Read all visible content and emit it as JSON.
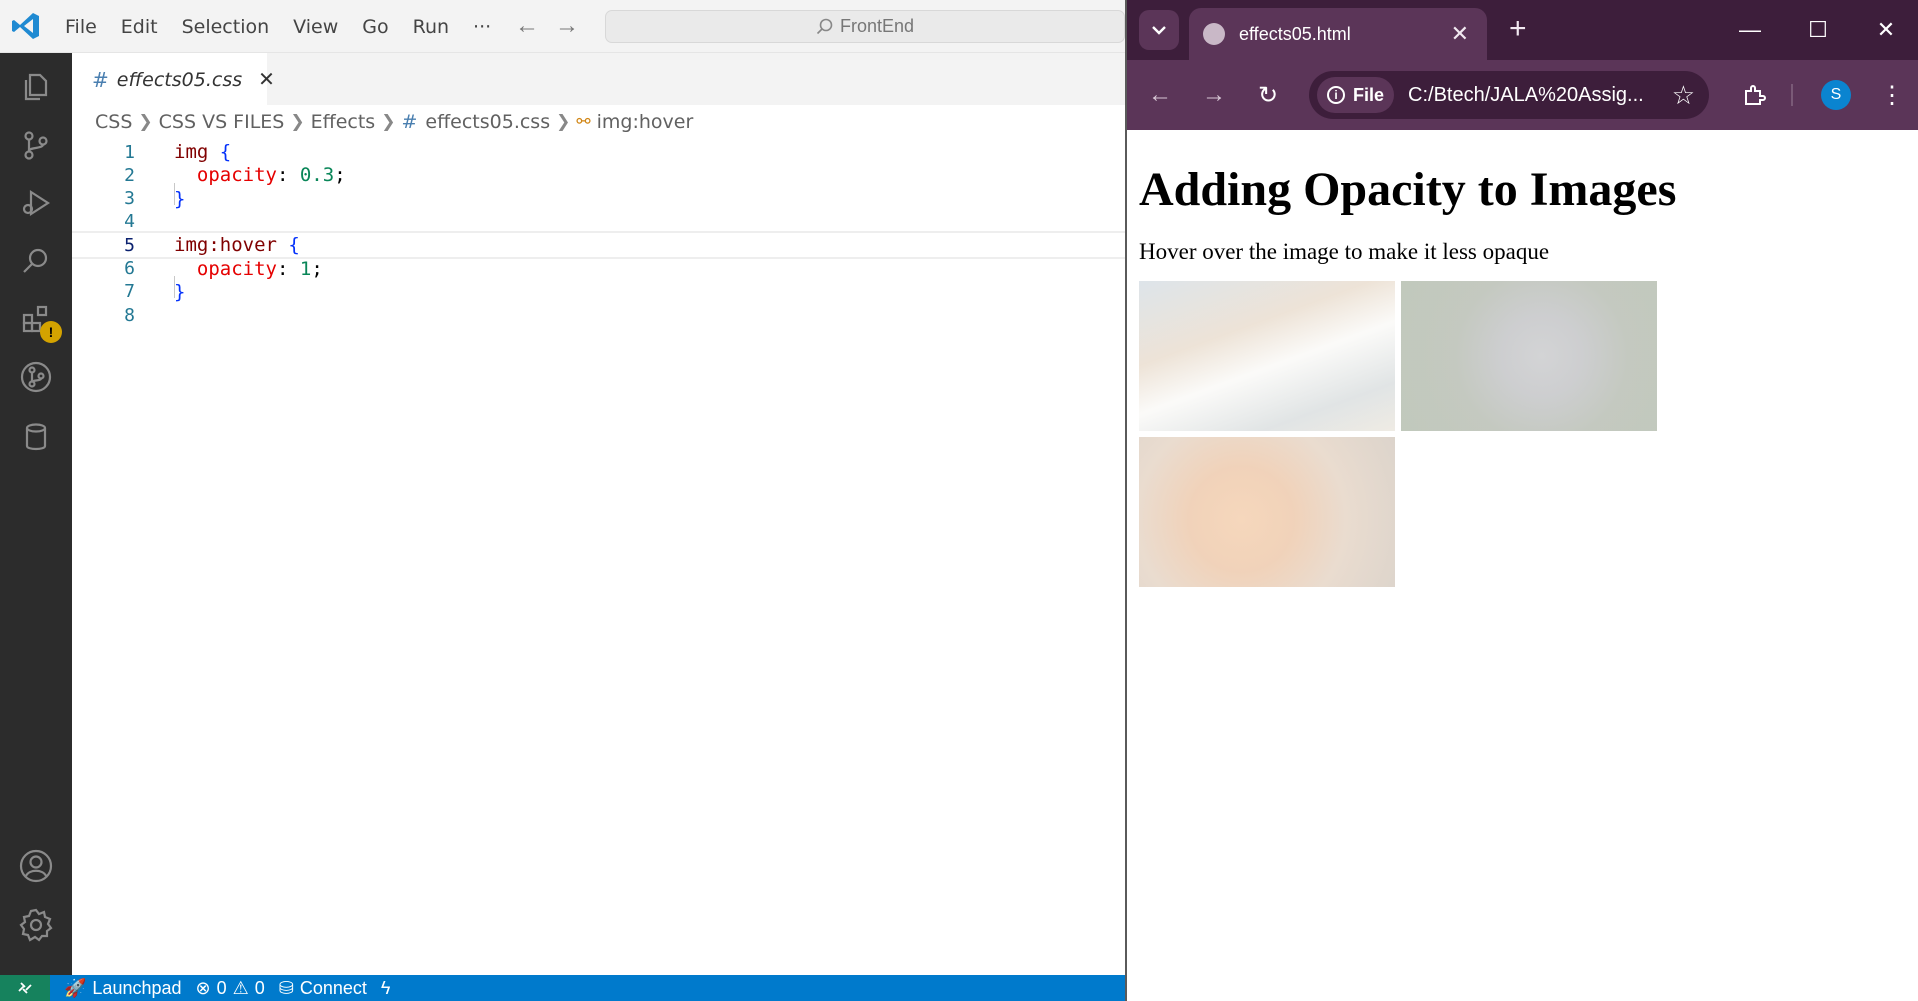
{
  "vscode": {
    "menu": [
      "File",
      "Edit",
      "Selection",
      "View",
      "Go",
      "Run",
      "···"
    ],
    "search_text": "FrontEnd",
    "tab": {
      "label": "effects05.css"
    },
    "breadcrumb": [
      "CSS",
      "CSS VS FILES",
      "Effects",
      "effects05.css",
      "img:hover"
    ],
    "code_lines": [
      {
        "n": "1",
        "tokens": [
          [
            "sel",
            "img"
          ],
          [
            "punc",
            " "
          ],
          [
            "brace",
            "{"
          ]
        ]
      },
      {
        "n": "2",
        "tokens": [
          [
            "punc",
            "  "
          ],
          [
            "prop",
            "opacity"
          ],
          [
            "punc",
            ": "
          ],
          [
            "num",
            "0.3"
          ],
          [
            "punc",
            ";"
          ]
        ]
      },
      {
        "n": "3",
        "tokens": [
          [
            "brace",
            "}"
          ]
        ]
      },
      {
        "n": "4",
        "tokens": []
      },
      {
        "n": "5",
        "tokens": [
          [
            "sel",
            "img:hover"
          ],
          [
            "punc",
            " "
          ],
          [
            "brace",
            "{"
          ]
        ]
      },
      {
        "n": "6",
        "tokens": [
          [
            "punc",
            "  "
          ],
          [
            "prop",
            "opacity"
          ],
          [
            "punc",
            ": "
          ],
          [
            "num",
            "1"
          ],
          [
            "punc",
            ";"
          ]
        ]
      },
      {
        "n": "7",
        "tokens": [
          [
            "brace",
            "}"
          ]
        ]
      },
      {
        "n": "8",
        "tokens": []
      }
    ],
    "current_line": 5,
    "status": {
      "launchpad": "Launchpad",
      "errors": "0",
      "warnings": "0",
      "connect": "Connect"
    }
  },
  "chrome": {
    "tab_title": "effects05.html",
    "chip_label": "File",
    "url": "C:/Btech/JALA%20Assig...",
    "profile_initial": "S",
    "page": {
      "heading": "Adding Opacity to Images",
      "paragraph": "Hover over the image to make it less opaque",
      "image_opacity": 0.3,
      "images": [
        "cat-image-calico",
        "cat-image-gray",
        "cat-image-orange"
      ]
    }
  },
  "colors": {
    "vscode_status": "#007acc",
    "vscode_remote": "#16825d",
    "chrome_frame": "#3d1e3b",
    "chrome_toolbar": "#5b3558"
  }
}
